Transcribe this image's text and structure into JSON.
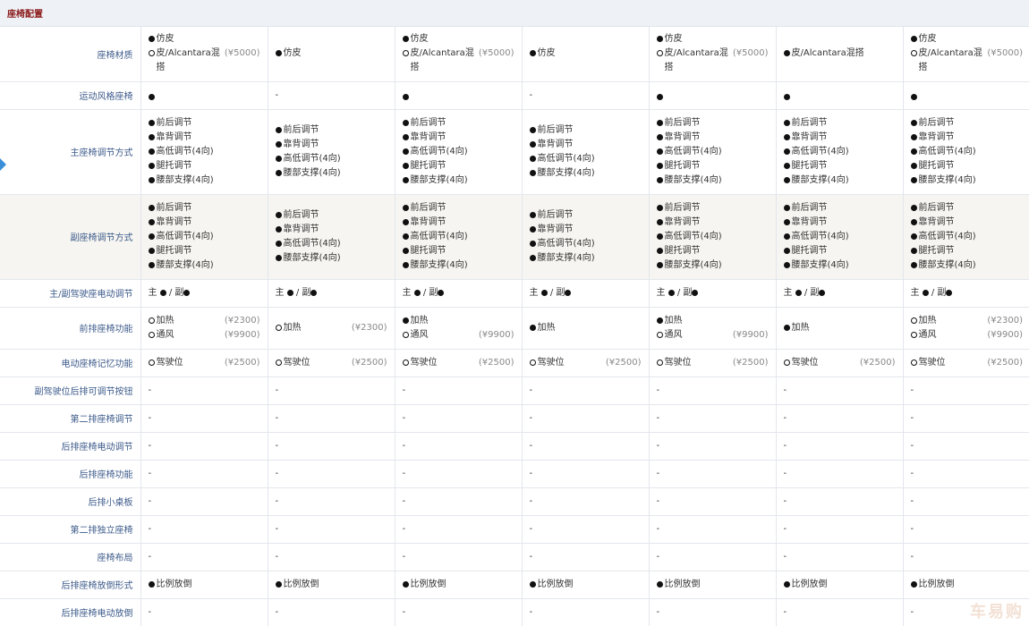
{
  "section": {
    "title": "座椅配置"
  },
  "watermark": "车易购",
  "rows": [
    {
      "label": "座椅材质",
      "height": 61,
      "cells": [
        [
          [
            "dot",
            "仿皮",
            ""
          ],
          [
            "circ",
            "皮/Alcantara混搭",
            "(¥5000)"
          ]
        ],
        [
          [
            "dot",
            "仿皮",
            ""
          ]
        ],
        [
          [
            "dot",
            "仿皮",
            ""
          ],
          [
            "circ",
            "皮/Alcantara混搭",
            "(¥5000)"
          ]
        ],
        [
          [
            "dot",
            "仿皮",
            ""
          ]
        ],
        [
          [
            "dot",
            "仿皮",
            ""
          ],
          [
            "circ",
            "皮/Alcantara混搭",
            "(¥5000)"
          ]
        ],
        [
          [
            "dot",
            "皮/Alcantara混搭",
            ""
          ]
        ],
        [
          [
            "dot",
            "仿皮",
            ""
          ],
          [
            "circ",
            "皮/Alcantara混搭",
            "(¥5000)"
          ]
        ]
      ]
    },
    {
      "label": "运动风格座椅",
      "height": 31,
      "cells": [
        [
          [
            "dot",
            "",
            ""
          ]
        ],
        [
          [
            "dash",
            "-",
            ""
          ]
        ],
        [
          [
            "dot",
            "",
            ""
          ]
        ],
        [
          [
            "dash",
            "-",
            ""
          ]
        ],
        [
          [
            "dot",
            "",
            ""
          ]
        ],
        [
          [
            "dot",
            "",
            ""
          ]
        ],
        [
          [
            "dot",
            "",
            ""
          ]
        ]
      ]
    },
    {
      "label": "主座椅调节方式",
      "height": 95,
      "cells": [
        [
          [
            "dot",
            "前后调节",
            ""
          ],
          [
            "dot",
            "靠背调节",
            ""
          ],
          [
            "dot",
            "高低调节(4向)",
            ""
          ],
          [
            "dot",
            "腿托调节",
            ""
          ],
          [
            "dot",
            "腰部支撑(4向)",
            ""
          ]
        ],
        [
          [
            "dot",
            "前后调节",
            ""
          ],
          [
            "dot",
            "靠背调节",
            ""
          ],
          [
            "dot",
            "高低调节(4向)",
            ""
          ],
          [
            "dot",
            "腰部支撑(4向)",
            ""
          ]
        ],
        [
          [
            "dot",
            "前后调节",
            ""
          ],
          [
            "dot",
            "靠背调节",
            ""
          ],
          [
            "dot",
            "高低调节(4向)",
            ""
          ],
          [
            "dot",
            "腿托调节",
            ""
          ],
          [
            "dot",
            "腰部支撑(4向)",
            ""
          ]
        ],
        [
          [
            "dot",
            "前后调节",
            ""
          ],
          [
            "dot",
            "靠背调节",
            ""
          ],
          [
            "dot",
            "高低调节(4向)",
            ""
          ],
          [
            "dot",
            "腰部支撑(4向)",
            ""
          ]
        ],
        [
          [
            "dot",
            "前后调节",
            ""
          ],
          [
            "dot",
            "靠背调节",
            ""
          ],
          [
            "dot",
            "高低调节(4向)",
            ""
          ],
          [
            "dot",
            "腿托调节",
            ""
          ],
          [
            "dot",
            "腰部支撑(4向)",
            ""
          ]
        ],
        [
          [
            "dot",
            "前后调节",
            ""
          ],
          [
            "dot",
            "靠背调节",
            ""
          ],
          [
            "dot",
            "高低调节(4向)",
            ""
          ],
          [
            "dot",
            "腿托调节",
            ""
          ],
          [
            "dot",
            "腰部支撑(4向)",
            ""
          ]
        ],
        [
          [
            "dot",
            "前后调节",
            ""
          ],
          [
            "dot",
            "靠背调节",
            ""
          ],
          [
            "dot",
            "高低调节(4向)",
            ""
          ],
          [
            "dot",
            "腿托调节",
            ""
          ],
          [
            "dot",
            "腰部支撑(4向)",
            ""
          ]
        ]
      ]
    },
    {
      "label": "副座椅调节方式",
      "height": 95,
      "alt": true,
      "cells": [
        [
          [
            "dot",
            "前后调节",
            ""
          ],
          [
            "dot",
            "靠背调节",
            ""
          ],
          [
            "dot",
            "高低调节(4向)",
            ""
          ],
          [
            "dot",
            "腿托调节",
            ""
          ],
          [
            "dot",
            "腰部支撑(4向)",
            ""
          ]
        ],
        [
          [
            "dot",
            "前后调节",
            ""
          ],
          [
            "dot",
            "靠背调节",
            ""
          ],
          [
            "dot",
            "高低调节(4向)",
            ""
          ],
          [
            "dot",
            "腰部支撑(4向)",
            ""
          ]
        ],
        [
          [
            "dot",
            "前后调节",
            ""
          ],
          [
            "dot",
            "靠背调节",
            ""
          ],
          [
            "dot",
            "高低调节(4向)",
            ""
          ],
          [
            "dot",
            "腿托调节",
            ""
          ],
          [
            "dot",
            "腰部支撑(4向)",
            ""
          ]
        ],
        [
          [
            "dot",
            "前后调节",
            ""
          ],
          [
            "dot",
            "靠背调节",
            ""
          ],
          [
            "dot",
            "高低调节(4向)",
            ""
          ],
          [
            "dot",
            "腰部支撑(4向)",
            ""
          ]
        ],
        [
          [
            "dot",
            "前后调节",
            ""
          ],
          [
            "dot",
            "靠背调节",
            ""
          ],
          [
            "dot",
            "高低调节(4向)",
            ""
          ],
          [
            "dot",
            "腿托调节",
            ""
          ],
          [
            "dot",
            "腰部支撑(4向)",
            ""
          ]
        ],
        [
          [
            "dot",
            "前后调节",
            ""
          ],
          [
            "dot",
            "靠背调节",
            ""
          ],
          [
            "dot",
            "高低调节(4向)",
            ""
          ],
          [
            "dot",
            "腿托调节",
            ""
          ],
          [
            "dot",
            "腰部支撑(4向)",
            ""
          ]
        ],
        [
          [
            "dot",
            "前后调节",
            ""
          ],
          [
            "dot",
            "靠背调节",
            ""
          ],
          [
            "dot",
            "高低调节(4向)",
            ""
          ],
          [
            "dot",
            "腿托调节",
            ""
          ],
          [
            "dot",
            "腰部支撑(4向)",
            ""
          ]
        ]
      ]
    },
    {
      "label": "主/副驾驶座电动调节",
      "height": 31,
      "mainsub": true,
      "cells": [
        [
          "主",
          "副"
        ],
        [
          "主",
          "副"
        ],
        [
          "主",
          "副"
        ],
        [
          "主",
          "副"
        ],
        [
          "主",
          "副"
        ],
        [
          "主",
          "副"
        ],
        [
          "主",
          "副"
        ]
      ]
    },
    {
      "label": "前排座椅功能",
      "height": 47,
      "cells": [
        [
          [
            "circ",
            "加热",
            "(¥2300)"
          ],
          [
            "circ",
            "通风",
            "(¥9900)"
          ]
        ],
        [
          [
            "circ",
            "加热",
            "(¥2300)"
          ]
        ],
        [
          [
            "dot",
            "加热",
            ""
          ],
          [
            "circ",
            "通风",
            "(¥9900)"
          ]
        ],
        [
          [
            "dot",
            "加热",
            ""
          ]
        ],
        [
          [
            "dot",
            "加热",
            ""
          ],
          [
            "circ",
            "通风",
            "(¥9900)"
          ]
        ],
        [
          [
            "dot",
            "加热",
            ""
          ]
        ],
        [
          [
            "circ",
            "加热",
            "(¥2300)"
          ],
          [
            "circ",
            "通风",
            "(¥9900)"
          ]
        ]
      ]
    },
    {
      "label": "电动座椅记忆功能",
      "height": 31,
      "cells": [
        [
          [
            "circ",
            "驾驶位",
            "(¥2500)"
          ]
        ],
        [
          [
            "circ",
            "驾驶位",
            "(¥2500)"
          ]
        ],
        [
          [
            "circ",
            "驾驶位",
            "(¥2500)"
          ]
        ],
        [
          [
            "circ",
            "驾驶位",
            "(¥2500)"
          ]
        ],
        [
          [
            "circ",
            "驾驶位",
            "(¥2500)"
          ]
        ],
        [
          [
            "circ",
            "驾驶位",
            "(¥2500)"
          ]
        ],
        [
          [
            "circ",
            "驾驶位",
            "(¥2500)"
          ]
        ]
      ]
    },
    {
      "label": "副驾驶位后排可调节按钮",
      "height": 31,
      "allDash": true
    },
    {
      "label": "第二排座椅调节",
      "height": 31,
      "allDash": true
    },
    {
      "label": "后排座椅电动调节",
      "height": 31,
      "allDash": true
    },
    {
      "label": "后排座椅功能",
      "height": 31,
      "allDash": true
    },
    {
      "label": "后排小桌板",
      "height": 31,
      "allDash": true
    },
    {
      "label": "第二排独立座椅",
      "height": 31,
      "allDash": true
    },
    {
      "label": "座椅布局",
      "height": 31,
      "allDash": true
    },
    {
      "label": "后排座椅放倒形式",
      "height": 31,
      "cells": [
        [
          [
            "dot",
            "比例放倒",
            ""
          ]
        ],
        [
          [
            "dot",
            "比例放倒",
            ""
          ]
        ],
        [
          [
            "dot",
            "比例放倒",
            ""
          ]
        ],
        [
          [
            "dot",
            "比例放倒",
            ""
          ]
        ],
        [
          [
            "dot",
            "比例放倒",
            ""
          ]
        ],
        [
          [
            "dot",
            "比例放倒",
            ""
          ]
        ],
        [
          [
            "dot",
            "比例放倒",
            ""
          ]
        ]
      ]
    },
    {
      "label": "后排座椅电动放倒",
      "height": 31,
      "allDash": true
    }
  ]
}
